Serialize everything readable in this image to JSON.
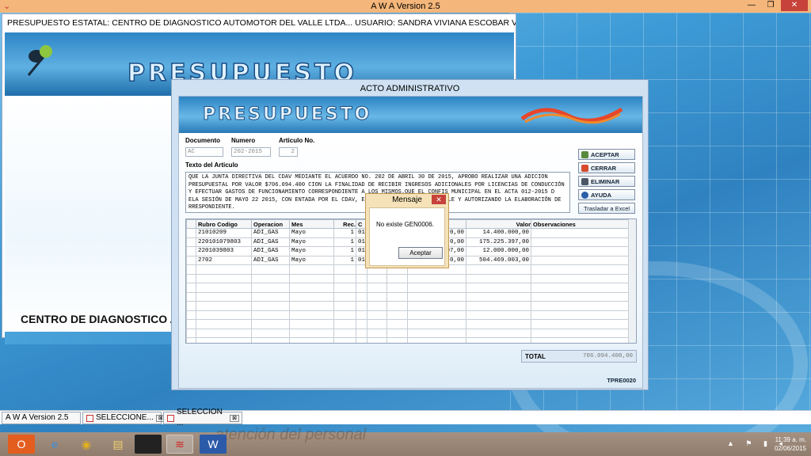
{
  "app": {
    "title": "A W A Version 2.5"
  },
  "main_window": {
    "caption": "PRESUPUESTO ESTATAL: CENTRO DE DIAGNOSTICO AUTOMOTOR DEL VALLE LTDA... USUARIO: SANDRA VIVIANA ESCOBAR VIG.:    2015  Plantilla ...",
    "banner_word": "PRESUPUESTO",
    "company_name": "CENTRO DE DIAGNOSTICO A"
  },
  "dialog": {
    "caption": "ACTO ADMINISTRATIVO",
    "banner_word": "PRESUPUESTO",
    "fields": {
      "documento_label": "Documento",
      "numero_label": "Numero",
      "articulo_label": "Articulo No.",
      "documento_value": "AC",
      "numero_value": "202-2015",
      "articulo_value": "2",
      "texto_label": "Texto del Articulo",
      "texto_value": "QUE LA JUNTA DIRECTIVA DEL CDAV MEDIANTE EL ACUERDO NO. 202 DE ABRIL 30 DE 2015, APROBO REALIZAR UNA ADICION PRESUPUESTAL POR VALOR $706.094.400 CION LA FINALIDAD DE RECIBIR INGRESOS ADICIONALES POR LICENCIAS DE CONDUCCIÓN Y EFECTUAR  GASTOS DE FUNCIONAMIENTO CORRESPONDIENTE A LOS MISMOS.QUE EL CONFIS MUNICIPAL EN EL ACTA 012-2015 D ELA SESIÓN DE MAYO 22 2015, CON                                 ENTADA POR EL CDAV, EMITIENDO CONCEPTO FAVORABLE Y AUTORIZANDO LA ELABORACIÓN DE                         RRESPONDIENTE."
    },
    "buttons": {
      "aceptar": "ACEPTAR",
      "cerrar": "CERRAR",
      "eliminar": "ELIMINAR",
      "ayuda": "AYUDA",
      "excel": "Trasladar a Excel"
    },
    "grid": {
      "headers": [
        "Rubro Codigo",
        "Operacion",
        "Mes",
        "Rec.",
        "C",
        "",
        "",
        "eferencia",
        "Valor",
        "Observaciones"
      ],
      "rows": [
        [
          "21010209",
          "ADI_GAS",
          "Mayo",
          "1",
          "01",
          "",
          "",
          "0,00",
          "14.400.000,00",
          ""
        ],
        [
          "220101079803",
          "ADI_GAS",
          "Mayo",
          "1",
          "01",
          "",
          "",
          "0,00",
          "175.225.397,00",
          ""
        ],
        [
          "2201039803",
          "ADI_GAS",
          "Mayo",
          "1",
          "01",
          "",
          "",
          ".407,00",
          "12.000.000,00",
          ""
        ],
        [
          "2702",
          "ADI_GAS",
          "Mayo",
          "1",
          "01",
          "",
          "",
          "0,00",
          "504.469.003,00",
          ""
        ]
      ],
      "empty_rows": 12
    },
    "total_label": "TOTAL",
    "total_value": "706.094.400,00",
    "form_code": "TPRE0020"
  },
  "message_box": {
    "title": "Mensaje",
    "close": "✕",
    "text": "No existe GEN0006.",
    "button": "Aceptar"
  },
  "mdi_tabs": [
    {
      "label": "A W A Version 2.5"
    },
    {
      "label": "SELECCIONE...",
      "close": "⊠"
    },
    {
      "label": "SELECCION ...",
      "close": "⊠"
    }
  ],
  "taskbar": {
    "ghost_text": "atención del personal",
    "time": "11:39 a. m.",
    "date": "02/06/2015"
  },
  "colors": {
    "accent": "#2e86c6",
    "titlebar": "#f4b67a",
    "close_red": "#c7423a"
  }
}
